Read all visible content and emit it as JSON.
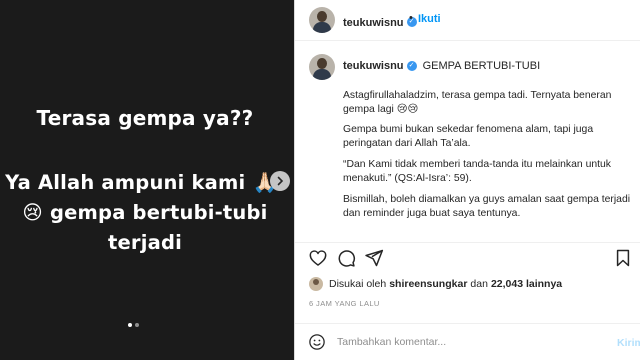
{
  "story": {
    "line1": "Terasa gempa ya??",
    "line2_text": "Ya Allah ampuni kami",
    "line2_emoji": "🙏🏻",
    "line3_emoji": "😢",
    "line3_text": "gempa bertubi-tubi",
    "line4": "terjadi",
    "next_icon": "chevron-right-icon",
    "dots": 2,
    "active_dot": 0
  },
  "header": {
    "username": "teukuwisnu",
    "separator": "•",
    "follow_label": "Ikuti"
  },
  "caption": {
    "username": "teukuwisnu",
    "title": "GEMPA BERTUBI-TUBI",
    "p1": "Astagfirullahaladzim, terasa gempa tadi. Ternyata beneran gempa lagi 😢😢",
    "p2": "Gempa bumi bukan sekedar fenomena alam, tapi juga peringatan dari Allah Ta’ala.",
    "p3": "“Dan Kami tidak memberi tanda-tanda itu melainkan untuk menakuti.” (QS:Al-Isra’: 59).",
    "p4": "Bismillah, boleh diamalkan ya guys amalan saat gempa terjadi dan reminder juga buat saya tentunya."
  },
  "likes": {
    "prefix": "Disukai oleh",
    "user": "shireensungkar",
    "middle": "dan",
    "count": "22,043 lainnya"
  },
  "time": "6 JAM YANG LALU",
  "comment": {
    "placeholder": "Tambahkan komentar...",
    "post_label": "Kirim"
  },
  "colors": {
    "accent": "#0095f6",
    "verified": "#3897f0",
    "story_bg": "#1b1b1b"
  }
}
